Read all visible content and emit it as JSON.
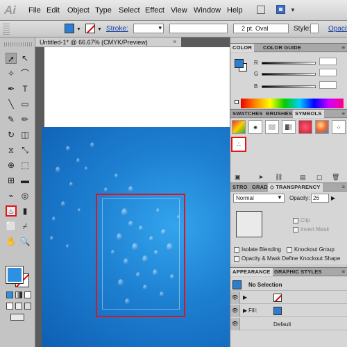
{
  "app": {
    "logo": "Ai"
  },
  "menubar": {
    "items": [
      "File",
      "Edit",
      "Object",
      "Type",
      "Select",
      "Effect",
      "View",
      "Window",
      "Help"
    ]
  },
  "controlbar": {
    "stroke_label": "Stroke:",
    "brush_definition": "2 pt. Oval",
    "style_label": "Style:",
    "opacity_label": "Opacity"
  },
  "document": {
    "tab_title": "Untitled-1* @ 66.67% (CMYK/Preview)",
    "close_glyph": "×"
  },
  "tools": [
    {
      "name": "selection-tool",
      "glyph": "➚"
    },
    {
      "name": "direct-selection-tool",
      "glyph": "↖"
    },
    {
      "name": "magic-wand-tool",
      "glyph": "✧"
    },
    {
      "name": "lasso-tool",
      "glyph": "⌒"
    },
    {
      "name": "pen-tool",
      "glyph": "✒"
    },
    {
      "name": "type-tool",
      "glyph": "T"
    },
    {
      "name": "line-tool",
      "glyph": "╲"
    },
    {
      "name": "rectangle-tool",
      "glyph": "▭"
    },
    {
      "name": "paintbrush-tool",
      "glyph": "✎"
    },
    {
      "name": "pencil-tool",
      "glyph": "✏"
    },
    {
      "name": "rotate-tool",
      "glyph": "↻"
    },
    {
      "name": "eraser-tool",
      "glyph": "◫"
    },
    {
      "name": "width-tool",
      "glyph": "⧖"
    },
    {
      "name": "scale-tool",
      "glyph": "⤡"
    },
    {
      "name": "shape-builder-tool",
      "glyph": "⊕"
    },
    {
      "name": "free-transform-tool",
      "glyph": "⬚"
    },
    {
      "name": "mesh-tool",
      "glyph": "⊞"
    },
    {
      "name": "gradient-tool",
      "glyph": "▬"
    },
    {
      "name": "eyedropper-tool",
      "glyph": "⌁"
    },
    {
      "name": "blend-tool",
      "glyph": "◎"
    },
    {
      "name": "symbol-sprayer-tool",
      "glyph": "♨"
    },
    {
      "name": "column-graph-tool",
      "glyph": "▮"
    },
    {
      "name": "artboard-tool",
      "glyph": "⬜"
    },
    {
      "name": "slice-tool",
      "glyph": "⌿"
    },
    {
      "name": "hand-tool",
      "glyph": "✋"
    },
    {
      "name": "zoom-tool",
      "glyph": "🔍"
    }
  ],
  "color_panel": {
    "tabs": [
      "COLOR",
      "COLOR GUIDE"
    ],
    "channels": [
      "R",
      "G",
      "B"
    ],
    "fill": "#2c7fd0"
  },
  "symbols_panel": {
    "tabs": [
      "SWATCHES",
      "BRUSHES",
      "SYMBOLS"
    ]
  },
  "transparency_panel": {
    "tabs": [
      "STRO",
      "GRAD",
      "◇ TRANSPARENCY"
    ],
    "blend_mode": "Normal",
    "opacity_label": "Opacity:",
    "opacity_value": "26",
    "clip_label": "Clip",
    "invert_mask_label": "Invert Mask",
    "isolate_blending_label": "Isolate Blending",
    "knockout_group_label": "Knockout Group",
    "opacity_mask_label": "Opacity & Mask Define Knockout Shape"
  },
  "appearance_panel": {
    "tabs": [
      "APPEARANCE",
      "GRAPHIC STYLES"
    ],
    "title": "No Selection",
    "fill_label": "Fill:",
    "default_label": "Default"
  },
  "colors": {
    "accent_blue": "#2c7fd0",
    "highlight_red": "#e0141b"
  }
}
